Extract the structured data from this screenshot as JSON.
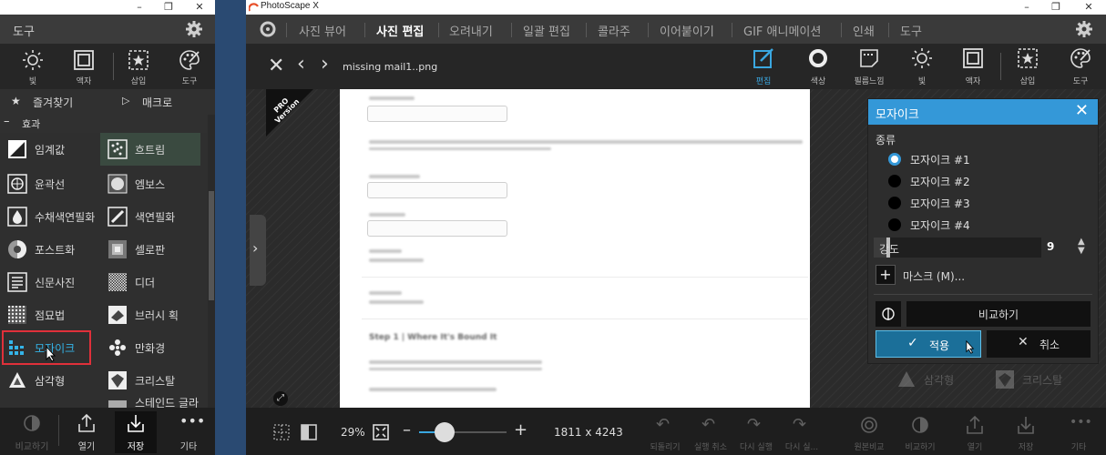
{
  "app": {
    "title": "PhotoScape X"
  },
  "left_window": {
    "menu_title": "도구",
    "toolbar": [
      {
        "label": "빛",
        "icon": "sun-icon"
      },
      {
        "label": "액자",
        "icon": "frame-icon"
      },
      {
        "label": "삽입",
        "icon": "insert-icon"
      },
      {
        "label": "도구",
        "icon": "palette-icon"
      }
    ],
    "favorites_label": "즐겨찾기",
    "macro_label": "매크로",
    "effects_label": "효과",
    "effects": [
      {
        "label": "임계값",
        "icon": "threshold-icon"
      },
      {
        "label": "흐트림",
        "icon": "scatter-icon"
      },
      {
        "label": "윤곽선",
        "icon": "outline-icon"
      },
      {
        "label": "엠보스",
        "icon": "emboss-icon"
      },
      {
        "label": "수채색연필화",
        "icon": "watercolor-icon"
      },
      {
        "label": "색연필화",
        "icon": "pencil-icon"
      },
      {
        "label": "포스트화",
        "icon": "posterize-icon"
      },
      {
        "label": "셀로판",
        "icon": "cellophane-icon"
      },
      {
        "label": "신문사진",
        "icon": "newspaper-icon"
      },
      {
        "label": "디더",
        "icon": "dither-icon"
      },
      {
        "label": "점묘법",
        "icon": "pointillism-icon"
      },
      {
        "label": "브러시 획",
        "icon": "brush-stroke-icon"
      },
      {
        "label": "모자이크",
        "icon": "mosaic-icon"
      },
      {
        "label": "만화경",
        "icon": "kaleidoscope-icon"
      },
      {
        "label": "삼각형",
        "icon": "triangle-icon"
      },
      {
        "label": "크리스탈",
        "icon": "crystal-icon"
      },
      {
        "label": "스테인드 글라",
        "icon": "stained-glass-icon"
      }
    ],
    "bottom": [
      {
        "label": "비교하기",
        "icon": "compare-icon"
      },
      {
        "label": "열기",
        "icon": "open-icon"
      },
      {
        "label": "저장",
        "icon": "save-icon"
      },
      {
        "label": "기타",
        "icon": "more-icon"
      }
    ]
  },
  "right_window": {
    "tabs": [
      "사진 뷰어",
      "사진 편집",
      "오려내기",
      "일괄 편집",
      "콜라주",
      "이어붙이기",
      "GIF 애니메이션",
      "인쇄",
      "도구"
    ],
    "active_tab": "사진 편집",
    "filename": "missing mail1..png",
    "edit_toolbar": [
      {
        "label": "편집",
        "icon": "edit-icon"
      },
      {
        "label": "색상",
        "icon": "color-circle-icon"
      },
      {
        "label": "필름느낌",
        "icon": "film-icon"
      },
      {
        "label": "빛",
        "icon": "sun-icon"
      },
      {
        "label": "액자",
        "icon": "frame-icon"
      },
      {
        "label": "삽입",
        "icon": "insert-icon"
      },
      {
        "label": "도구",
        "icon": "palette-icon"
      }
    ],
    "doc_heading": "Step 1 | Where It's Bound It",
    "pro_badge": "PRO Version",
    "zoom": "29%",
    "zoom_level": 0.29,
    "dimensions": "1811 x 4243",
    "bottom_dim": [
      {
        "label": "되돌리기",
        "icon": "undo-all-icon"
      },
      {
        "label": "실행 취소",
        "icon": "undo-icon"
      },
      {
        "label": "다시 실행",
        "icon": "redo-icon"
      },
      {
        "label": "다시 실...",
        "icon": "redo-all-icon"
      },
      {
        "label": "원본비교",
        "icon": "original-icon"
      },
      {
        "label": "비교하기",
        "icon": "compare-icon"
      },
      {
        "label": "열기",
        "icon": "open-icon"
      },
      {
        "label": "저장",
        "icon": "save-icon"
      },
      {
        "label": "기타",
        "icon": "more-icon"
      }
    ]
  },
  "mosaic_panel": {
    "title": "모자이크",
    "type_label": "종류",
    "options": [
      "모자이크 #1",
      "모자이크 #2",
      "모자이크 #3",
      "모자이크 #4"
    ],
    "selected_option": "모자이크 #1",
    "strength_label": "강도",
    "strength_value": "9",
    "mask_label": "마스크 (M)...",
    "compare_label": "비교하기",
    "apply_label": "적용",
    "cancel_label": "취소"
  },
  "colors": {
    "accent": "#3498d8",
    "highlight_border": "#e0303a",
    "bg": "#2a4a72"
  }
}
